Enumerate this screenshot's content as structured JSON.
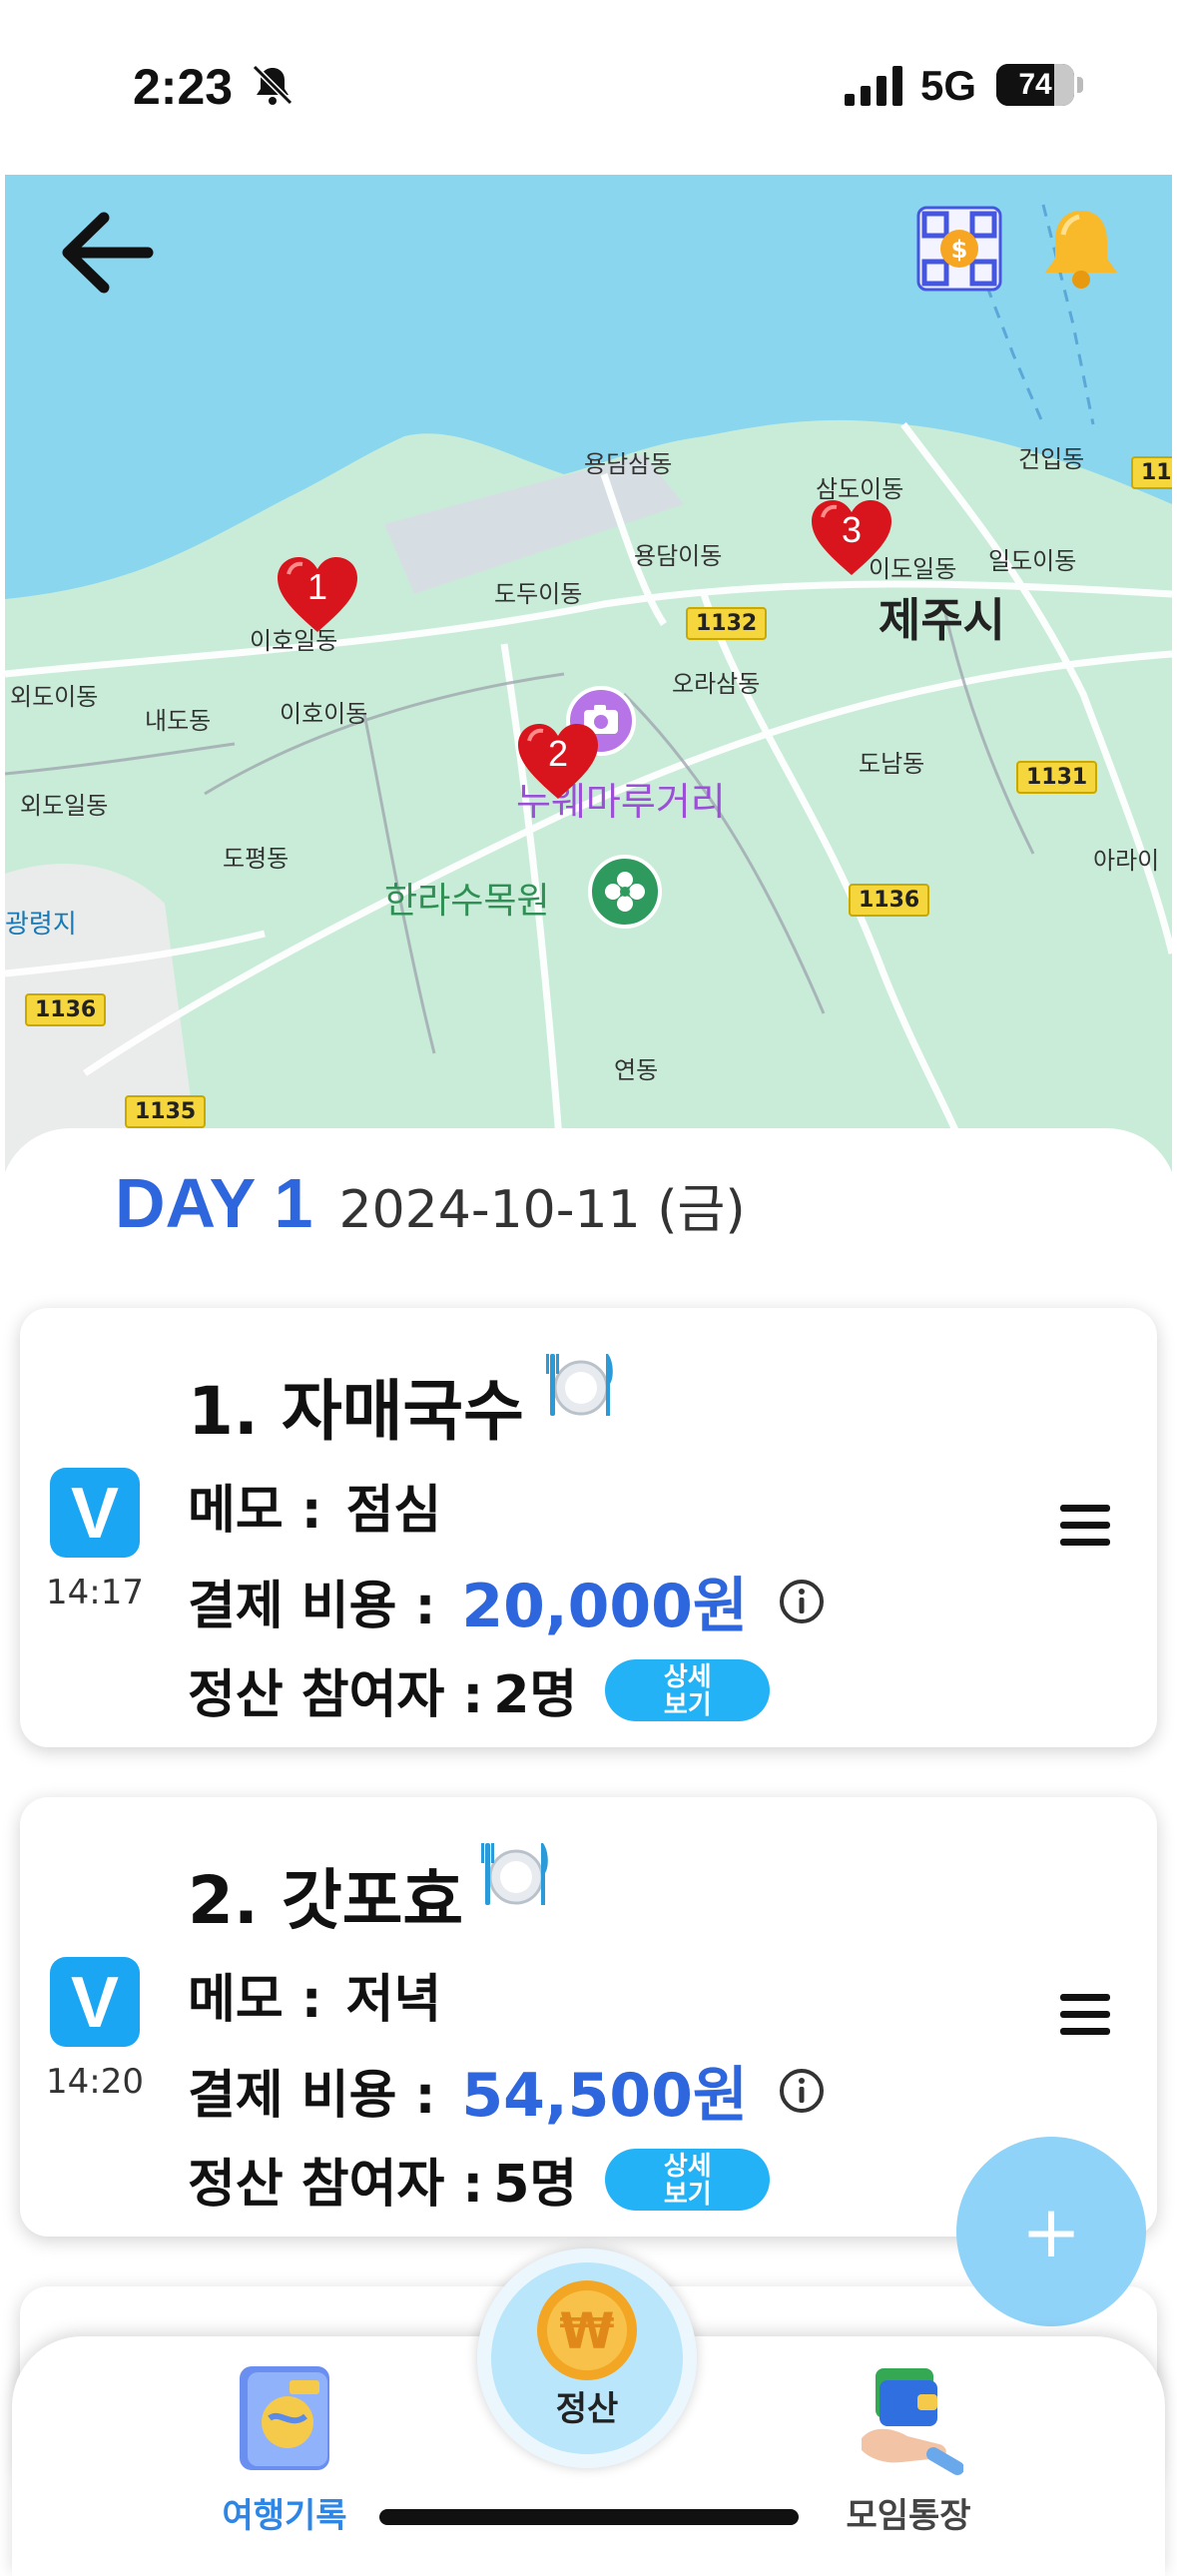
{
  "status_bar": {
    "time": "2:23",
    "network": "5G",
    "battery": "74",
    "battery_level": 0.74
  },
  "map": {
    "labels": [
      {
        "text": "용담삼동",
        "cls": "lbl"
      },
      {
        "text": "삼도이동",
        "cls": "lbl"
      },
      {
        "text": "건입동",
        "cls": "lbl"
      },
      {
        "text": "용담이동",
        "cls": "lbl"
      },
      {
        "text": "도두이동",
        "cls": "lbl"
      },
      {
        "text": "이도일동",
        "cls": "lbl"
      },
      {
        "text": "일도이동",
        "cls": "lbl"
      },
      {
        "text": "제주시",
        "cls": "lbl big"
      },
      {
        "text": "이호일동",
        "cls": "lbl"
      },
      {
        "text": "오라삼동",
        "cls": "lbl"
      },
      {
        "text": "외도이동",
        "cls": "lbl"
      },
      {
        "text": "내도동",
        "cls": "lbl"
      },
      {
        "text": "이호이동",
        "cls": "lbl"
      },
      {
        "text": "도남동",
        "cls": "lbl"
      },
      {
        "text": "누웨마루거리",
        "cls": "lbl purple"
      },
      {
        "text": "외도일동",
        "cls": "lbl"
      },
      {
        "text": "도평동",
        "cls": "lbl"
      },
      {
        "text": "아라이",
        "cls": "lbl"
      },
      {
        "text": "한라수목원",
        "cls": "lbl green"
      },
      {
        "text": "광령지",
        "cls": "lbl teal"
      },
      {
        "text": "연동",
        "cls": "lbl"
      }
    ],
    "routes": [
      "1132",
      "1131",
      "1136",
      "1136",
      "1135",
      "11"
    ],
    "pins": [
      "1",
      "2",
      "3"
    ]
  },
  "day": {
    "label": "DAY 1",
    "date": "2024-10-11 (금)"
  },
  "records": [
    {
      "title": "1. 자매국수",
      "time": "14:17",
      "badge": "V",
      "memo_label": "메모 :",
      "memo": "점심",
      "cost_label": "결제 비용 :",
      "cost": "20,000원",
      "participants_label": "정산 참여자 :",
      "participants": "2명",
      "detail_button": "상세\n보기"
    },
    {
      "title": "2. 갓포효",
      "time": "14:20",
      "badge": "V",
      "memo_label": "메모 :",
      "memo": "저녁",
      "cost_label": "결제 비용 :",
      "cost": "54,500원",
      "participants_label": "정산 참여자 :",
      "participants": "5명",
      "detail_button": "상세\n보기"
    }
  ],
  "fab": {
    "symbol": "+"
  },
  "bottom_nav": {
    "record": "여행기록",
    "settle": "정산",
    "wallet": "모임통장"
  },
  "colors": {
    "accent": "#2d66dd",
    "badge": "#1aa6f2",
    "fab": "#8fd3f8",
    "map": "#c8ecd8"
  }
}
